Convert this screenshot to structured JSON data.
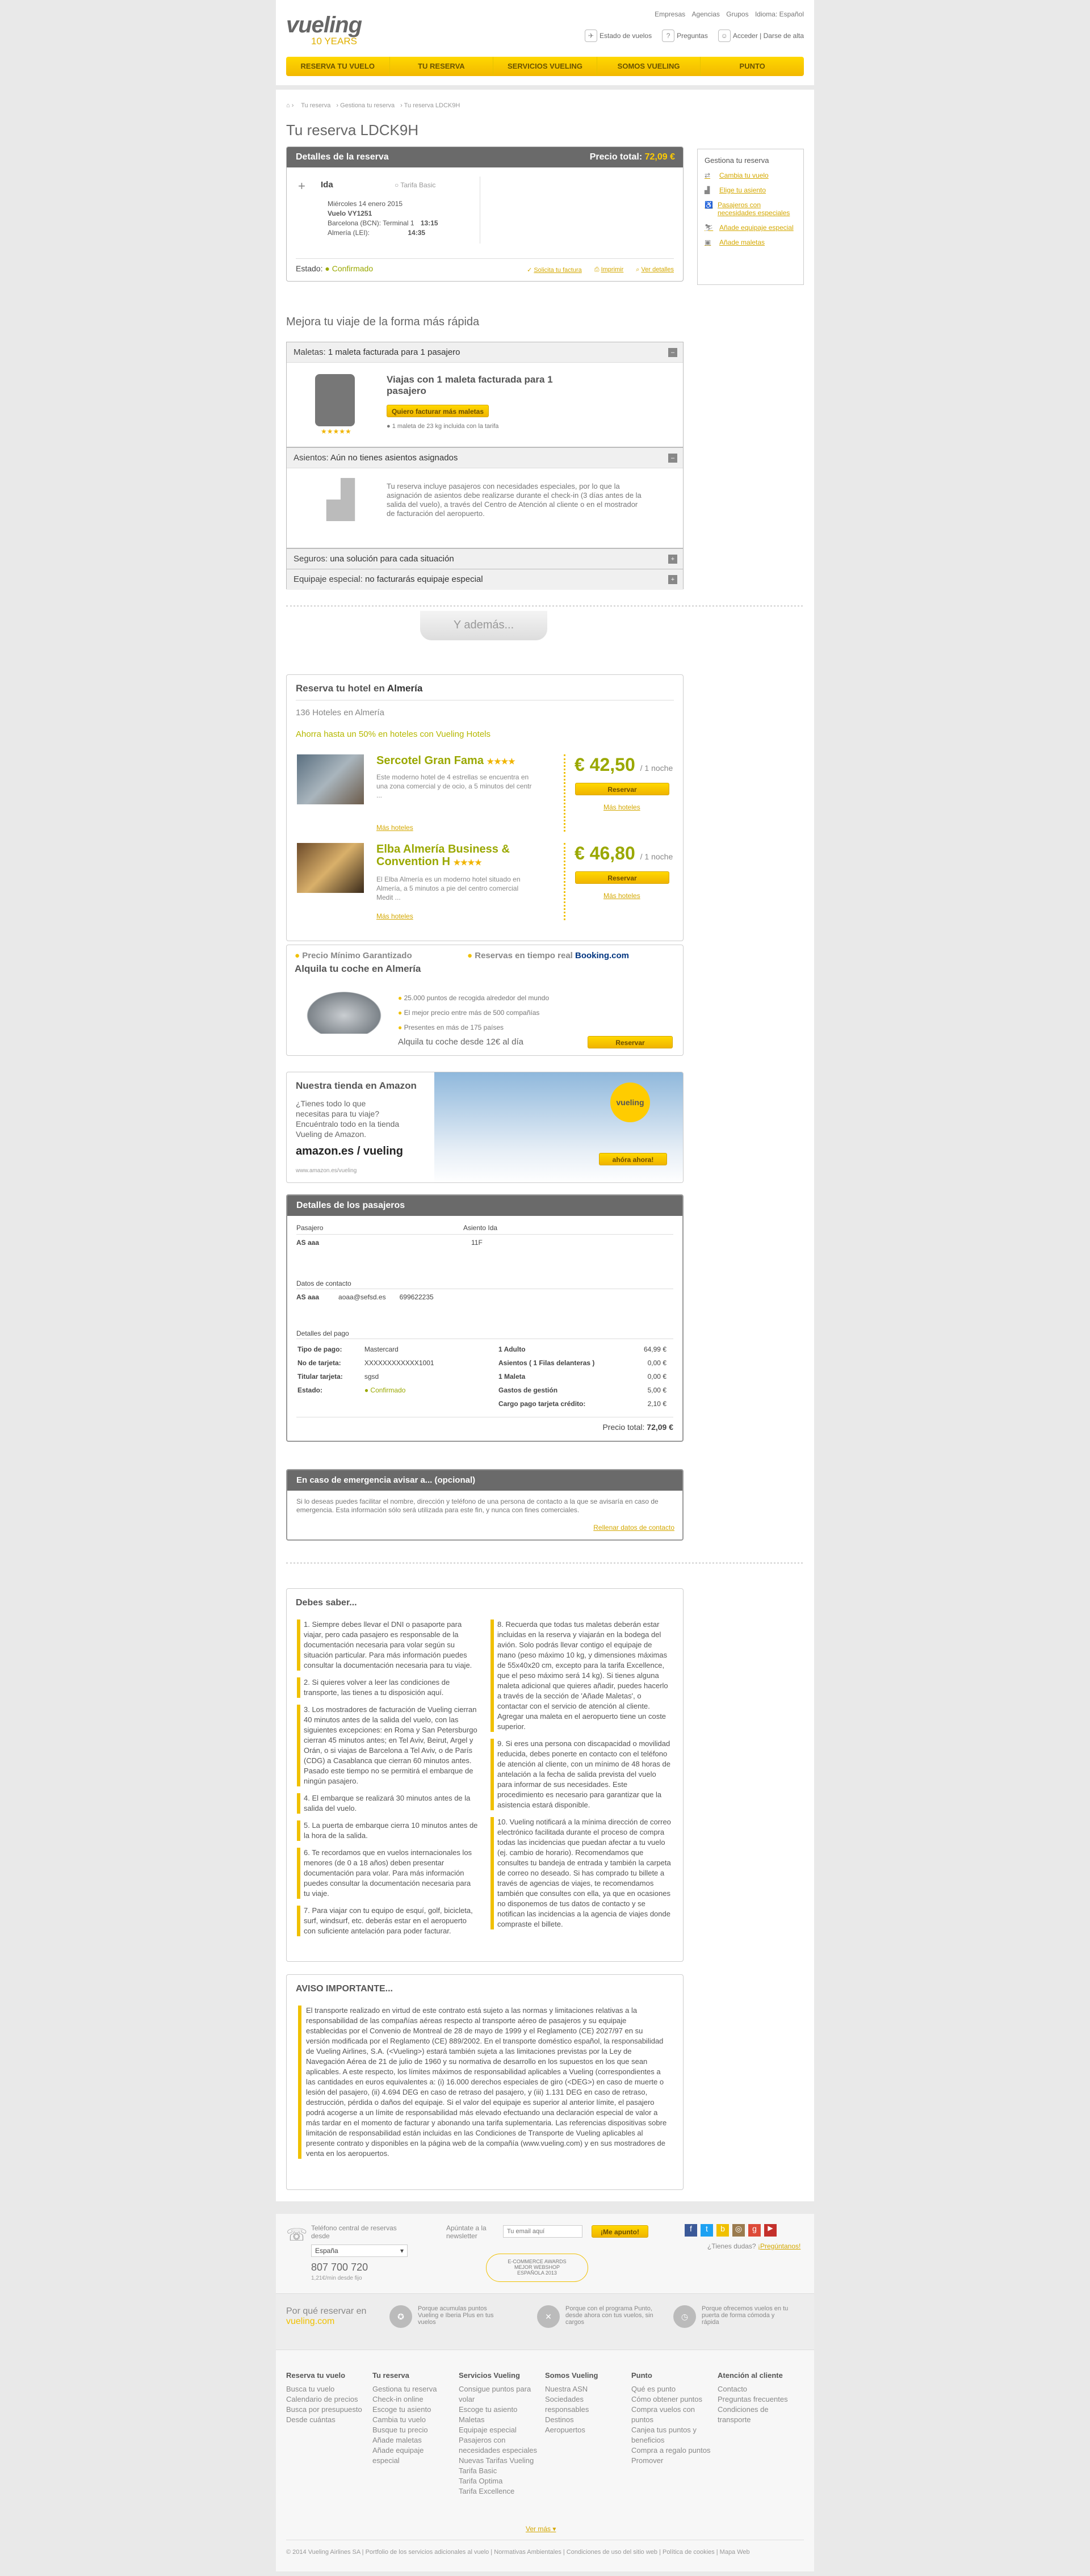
{
  "header": {
    "brand": "vueling",
    "years": "10 YEARS",
    "toplinks": [
      "Empresas",
      "Agencias",
      "Grupos",
      "Idioma: Español"
    ],
    "estado": "Estado de vuelos",
    "preguntas": "Preguntas",
    "login": "Acceder | Darse de alta",
    "nav": [
      "RESERVA TU VUELO",
      "TU RESERVA",
      "SERVICIOS VUELING",
      "SOMOS VUELING",
      "PUNTO"
    ]
  },
  "breadcrumb": [
    "Tu reserva",
    "Gestiona tu reserva",
    "Tu reserva LDCK9H"
  ],
  "title": "Tu reserva LDCK9H",
  "booking": {
    "header": "Detalles de la reserva",
    "total_label": "Precio total:",
    "total": "72,09 €",
    "ida": "Ida",
    "tarifa": "Tarifa Basic",
    "date": "Miércoles 14 enero 2015",
    "flight": "Vuelo VY1251",
    "from": "Barcelona (BCN): Terminal 1",
    "from_time": "13:15",
    "to": "Almería (LEI):",
    "to_time": "14:35",
    "estado_label": "Estado:",
    "estado": "Confirmado",
    "actions": [
      "Solicita tu factura",
      "Imprimir",
      "Ver detalles"
    ]
  },
  "sidebar": {
    "title": "Gestiona tu reserva",
    "items": [
      "Cambia tu vuelo",
      "Elige tu asiento",
      "Pasajeros con necesidades especiales",
      "Añade equipaje especial",
      "Añade maletas"
    ]
  },
  "mejora": {
    "title": "Mejora tu viaje de la forma más rápida",
    "maletas_label": "Maletas:",
    "maletas": "1 maleta facturada para 1 pasajero",
    "maletas_text": "Viajas con 1 maleta facturada para 1 pasajero",
    "maletas_btn": "Quiero facturar más maletas",
    "maletas_note": "1 maleta de 23 kg incluida con la tarifa",
    "asientos_label": "Asientos:",
    "asientos": "Aún no tienes asientos asignados",
    "asientos_text": "Tu reserva incluye pasajeros con necesidades especiales, por lo que la asignación de asientos debe realizarse durante el check-in (3 días antes de la salida del vuelo), a través del Centro de Atención al cliente o en el mostrador de facturación del aeropuerto.",
    "seguros_label": "Seguros:",
    "seguros": "una solución para cada situación",
    "equipaje_label": "Equipaje especial:",
    "equipaje": "no facturarás equipaje especial"
  },
  "ademas": "Y además...",
  "hotels": {
    "title_pre": "Reserva tu hotel en",
    "city": "Almería",
    "count": "136 Hoteles en Almería",
    "promo": "Ahorra hasta un 50% en hoteles con Vueling Hotels",
    "list": [
      {
        "name": "Sercotel Gran Fama",
        "stars": "★★★★",
        "desc": "Este moderno hotel de 4 estrellas se encuentra en una zona comercial y de ocio, a 5 minutos del centr ...",
        "link": "Más hoteles",
        "price": "€ 42,50",
        "per": "/ 1 noche",
        "btn": "Reservar",
        "more": "Más hoteles"
      },
      {
        "name": "Elba Almería Business & Convention H",
        "stars": "★★★★",
        "desc": "El Elba Almería es un moderno hotel situado en Almería, a 5 minutos a pie del centro comercial Medit ...",
        "link": "Más hoteles",
        "price": "€ 46,80",
        "per": "/ 1 noche",
        "btn": "Reservar",
        "more": "Más hoteles"
      }
    ]
  },
  "car": {
    "g1": "Precio Mínimo Garantizado",
    "g2": "Reservas en tiempo real",
    "booking": "Booking.com",
    "title": "Alquila tu coche en Almería",
    "points": [
      "25.000 puntos de recogida alrededor del mundo",
      "El mejor precio entre más de 500 compañías",
      "Presentes en más de 175 países"
    ],
    "price": "Alquila tu coche desde 12€ al día",
    "btn": "Reservar"
  },
  "amazon": {
    "title": "Nuestra tienda en Amazon",
    "text": "¿Tienes todo lo que necesitas para tu viaje? Encuéntralo todo en la tienda Vueling de Amazon.",
    "logo": "amazon.es / vueling",
    "url": "www.amazon.es/vueling",
    "btn": "ahóra ahora!"
  },
  "pax": {
    "header": "Detalles de los pasajeros",
    "col1": "Pasajero",
    "col2": "Asiento Ida",
    "name": "AS aaa",
    "seat": "11F",
    "contact_title": "Datos de contacto",
    "contact_name": "AS aaa",
    "email": "aoaa@sefsd.es",
    "phone": "699622235",
    "pay_title": "Detalles del pago",
    "pay": [
      [
        "Tipo de pago:",
        "Mastercard"
      ],
      [
        "No de tarjeta:",
        "XXXXXXXXXXXX1001"
      ],
      [
        "Titular tarjeta:",
        "sgsd"
      ],
      [
        "Estado:",
        "Confirmado"
      ]
    ],
    "fees": [
      [
        "1 Adulto",
        "64,99 €"
      ],
      [
        "Asientos ( 1 Filas delanteras )",
        "0,00 €"
      ],
      [
        "1 Maleta",
        "0,00 €"
      ],
      [
        "Gastos de gestión",
        "5,00 €"
      ],
      [
        "Cargo pago tarjeta crédito:",
        "2,10 €"
      ]
    ],
    "total_label": "Precio total:",
    "total": "72,09 €"
  },
  "emergency": {
    "header": "En caso de emergencia avisar a... (opcional)",
    "text": "Si lo deseas puedes facilitar el nombre, dirección y teléfono de una persona de contacto a la que se avisaría en caso de emergencia. Esta información sólo será utilizada para este fin, y nunca con fines comerciales.",
    "link": "Rellenar datos de contacto"
  },
  "debes": {
    "title": "Debes saber...",
    "left": [
      "1. Siempre debes llevar el DNI o pasaporte para viajar, pero cada pasajero es responsable de la documentación necesaria para volar según su situación particular. Para más información puedes consultar la documentación necesaria para tu viaje.",
      "2. Si quieres volver a leer las condiciones de transporte, las tienes a tu disposición aquí.",
      "3. Los mostradores de facturación de Vueling cierran 40 minutos antes de la salida del vuelo, con las siguientes excepciones: en Roma y San Petersburgo cierran 45 minutos antes; en Tel Aviv, Beirut, Argel y Orán, o si viajas de Barcelona a Tel Aviv, o de París (CDG) a Casablanca que cierran 60 minutos antes. Pasado este tiempo no se permitirá el embarque de ningún pasajero.",
      "4. El embarque se realizará 30 minutos antes de la salida del vuelo.",
      "5. La puerta de embarque cierra 10 minutos antes de la hora de la salida.",
      "6. Te recordamos que en vuelos internacionales los menores (de 0 a 18 años) deben presentar documentación para volar. Para más información puedes consultar la documentación necesaria para tu viaje.",
      "7. Para viajar con tu equipo de esquí, golf, bicicleta, surf, windsurf, etc. deberás estar en el aeropuerto con suficiente antelación para poder facturar."
    ],
    "right": [
      "8. Recuerda que todas tus maletas deberán estar incluidas en la reserva y viajarán en la bodega del avión. Solo podrás llevar contigo el equipaje de mano (peso máximo 10 kg, y dimensiones máximas de 55x40x20 cm, excepto para la tarifa Excellence, que el peso máximo será 14 kg). Si tienes alguna maleta adicional que quieres añadir, puedes hacerlo a través de la sección de 'Añade Maletas', o contactar con el servicio de atención al cliente. Agregar una maleta en el aeropuerto tiene un coste superior.",
      "9. Si eres una persona con discapacidad o movilidad reducida, debes ponerte en contacto con el teléfono de atención al cliente, con un mínimo de 48 horas de antelación a la fecha de salida prevista del vuelo para informar de sus necesidades. Este procedimiento es necesario para garantizar que la asistencia estará disponible.",
      "10. Vueling notificará a la mínima dirección de correo electrónico facilitada durante el proceso de compra todas las incidencias que puedan afectar a tu vuelo (ej. cambio de horario). Recomendamos que consultes tu bandeja de entrada y también la carpeta de correo no deseado. Si has comprado tu billete a través de agencias de viajes, te recomendamos también que consultes con ella, ya que en ocasiones no disponemos de tus datos de contacto y se notifican las incidencias a la agencia de viajes donde compraste el billete."
    ]
  },
  "aviso": {
    "title": "AVISO IMPORTANTE...",
    "text": "El transporte realizado en virtud de este contrato está sujeto a las normas y limitaciones relativas a la responsabilidad de las compañías aéreas respecto al transporte aéreo de pasajeros y su equipaje establecidas por el Convenio de Montreal de 28 de mayo de 1999 y el Reglamento (CE) 2027/97 en su versión modificada por el Reglamento (CE) 889/2002. En el transporte doméstico español, la responsabilidad de Vueling Airlines, S.A. (<Vueling>) estará también sujeta a las limitaciones previstas por la Ley de Navegación Aérea de 21 de julio de 1960 y su normativa de desarrollo en los supuestos en los que sean aplicables. A este respecto, los límites máximos de responsabilidad aplicables a Vueling (correspondientes a las cantidades en euros equivalentes a: (i) 16.000 derechos especiales de giro (<DEG>) en caso de muerte o lesión del pasajero, (ii) 4.694 DEG en caso de retraso del pasajero, y (iii) 1.131 DEG en caso de retraso, destrucción, pérdida o daños del equipaje. Si el valor del equipaje es superior al anterior límite, el pasajero podrá acogerse a un límite de responsabilidad más elevado efectuando una declaración especial de valor a más tardar en el momento de facturar y abonando una tarifa suplementaria. Las referencias dispositivas sobre limitación de responsabilidad están incluidas en las Condiciones de Transporte de Vueling aplicables al presente contrato y disponibles en la página web de la compañía (www.vueling.com) y en sus mostradores de venta en los aeropuertos."
  },
  "footer": {
    "phone_label": "Teléfono central de reservas desde",
    "country": "España",
    "phone": "807 700 720",
    "phone_note": "1,21€/min desde fijo",
    "newsletter_label": "Apúntate a la newsletter",
    "email_ph": "Tu email aquí",
    "news_btn": "¡Me apunto!",
    "dudas": "¿Tienes dudas?",
    "preguntanos": "¡Pregúntanos!",
    "award": "E-COMMERCE AWARDS MEJOR WEBSHOP ESPAÑOLA 2013",
    "por_que": "Por qué reservar en",
    "site": "vueling.com",
    "reasons": [
      "Porque acumulas puntos Vueling e Iberia Plus en tus vuelos",
      "Porque con el programa Punto, desde ahora con tus vuelos, sin cargos",
      "Porque ofrecemos vuelos en tu puerta de forma cómoda y rápida"
    ],
    "cols": [
      {
        "h": "Reserva tu vuelo",
        "i": [
          "Busca tu vuelo",
          "Calendario de precios",
          "Busca por presupuesto",
          "Desde cuántas"
        ]
      },
      {
        "h": "Tu reserva",
        "i": [
          "Gestiona tu reserva",
          "Check-in online",
          "Escoge tu asiento",
          "Cambia tu vuelo",
          "Busque tu precio",
          "Añade maletas",
          "Añade equipaje especial"
        ]
      },
      {
        "h": "Servicios Vueling",
        "i": [
          "Consigue puntos para volar",
          "Escoge tu asiento",
          "Maletas",
          "Equipaje especial",
          "Pasajeros con necesidades especiales",
          "Nuevas Tarifas Vueling",
          "Tarifa Basic",
          "Tarifa Optima",
          "Tarifa Excellence"
        ]
      },
      {
        "h": "Somos Vueling",
        "i": [
          "Nuestra ASN",
          "Sociedades responsables",
          "Destinos",
          "Aeropuertos"
        ]
      },
      {
        "h": "Punto",
        "i": [
          "Qué es punto",
          "Cómo obtener puntos",
          "Compra vuelos con puntos",
          "Canjea tus puntos y beneficios",
          "Compra a regalo puntos",
          "Promover"
        ]
      },
      {
        "h": "Atención al cliente",
        "i": [
          "Contacto",
          "Preguntas frecuentes",
          "Condiciones de transporte"
        ]
      }
    ],
    "ver_mas": "Ver más",
    "copyright": "© 2014 Vueling Airlines SA | Portfolio de los servicios adicionales al vuelo | Normativas Ambientales | Condiciones de uso del sitio web | Política de cookies | Mapa Web"
  },
  "colors": {
    "accent": "#f0c000",
    "dark": "#6a6a6a",
    "olive": "#9aa800"
  }
}
